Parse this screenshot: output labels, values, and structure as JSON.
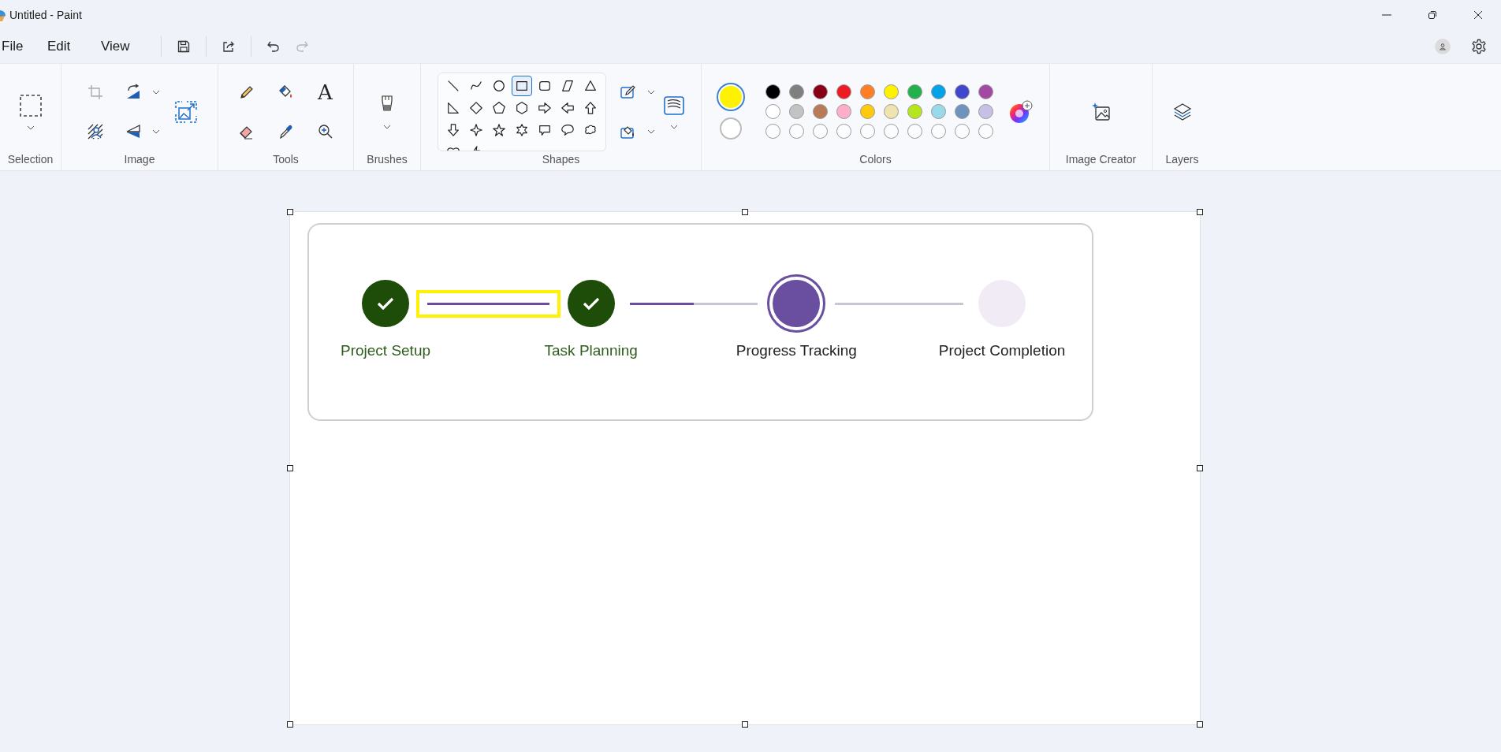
{
  "window": {
    "title": "Untitled - Paint"
  },
  "menu": [
    {
      "label": "File"
    },
    {
      "label": "Edit"
    },
    {
      "label": "View"
    }
  ],
  "ribbon": {
    "groups": [
      "Selection",
      "Image",
      "Tools",
      "Brushes",
      "Shapes",
      "Colors",
      "Image Creator",
      "Layers"
    ],
    "text_tool": "A",
    "shapes": [
      {
        "kind": "line",
        "selected": false
      },
      {
        "kind": "curve",
        "selected": false
      },
      {
        "kind": "oval",
        "selected": false
      },
      {
        "kind": "rectangle",
        "selected": true
      },
      {
        "kind": "rounded-rectangle",
        "selected": false
      },
      {
        "kind": "polygon",
        "selected": false
      },
      {
        "kind": "triangle",
        "selected": false
      },
      {
        "kind": "right-triangle",
        "selected": false
      },
      {
        "kind": "diamond",
        "selected": false
      },
      {
        "kind": "pentagon",
        "selected": false
      },
      {
        "kind": "hexagon",
        "selected": false
      },
      {
        "kind": "right-arrow",
        "selected": false
      },
      {
        "kind": "left-arrow",
        "selected": false
      },
      {
        "kind": "up-arrow",
        "selected": false
      },
      {
        "kind": "down-arrow",
        "selected": false
      },
      {
        "kind": "four-point-star",
        "selected": false
      },
      {
        "kind": "five-point-star",
        "selected": false
      },
      {
        "kind": "six-point-star",
        "selected": false
      },
      {
        "kind": "rectangle-callout",
        "selected": false
      },
      {
        "kind": "oval-callout",
        "selected": false
      },
      {
        "kind": "cloud-callout",
        "selected": false
      },
      {
        "kind": "heart",
        "selected": false
      },
      {
        "kind": "lightning",
        "selected": false
      }
    ],
    "primary_color": {
      "color": "#fff200",
      "selected": true
    },
    "secondary_color": {
      "color": "#ffffff",
      "selected": false
    },
    "palette": [
      {
        "color": "#000000"
      },
      {
        "color": "#7f7f7f"
      },
      {
        "color": "#880015"
      },
      {
        "color": "#ed1c24"
      },
      {
        "color": "#ff7f27"
      },
      {
        "color": "#fff200"
      },
      {
        "color": "#22b14c"
      },
      {
        "color": "#00a2e8"
      },
      {
        "color": "#3f48cc"
      },
      {
        "color": "#a349a4"
      },
      {
        "color": "#ffffff"
      },
      {
        "color": "#c3c3c3"
      },
      {
        "color": "#b97a57"
      },
      {
        "color": "#ffaec9"
      },
      {
        "color": "#ffc90e"
      },
      {
        "color": "#efe4b0"
      },
      {
        "color": "#b5e61d"
      },
      {
        "color": "#99d9ea"
      },
      {
        "color": "#7092be"
      },
      {
        "color": "#c8bfe7"
      }
    ]
  },
  "stepper": {
    "steps": [
      {
        "label": "Project Setup",
        "done": true,
        "active": false
      },
      {
        "label": "Task Planning",
        "done": true,
        "active": false
      },
      {
        "label": "Progress Tracking",
        "done": false,
        "active": true
      },
      {
        "label": "Project Completion",
        "done": false,
        "active": false
      }
    ],
    "connectors": [
      {
        "level": 1,
        "selected": true
      },
      {
        "level": 0.5,
        "selected": false
      },
      {
        "level": 0,
        "selected": false
      }
    ]
  }
}
